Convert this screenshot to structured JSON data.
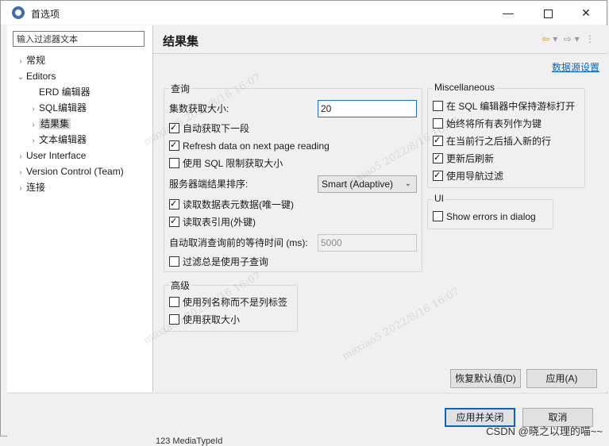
{
  "window": {
    "title": "首选项",
    "minimize_label": "—",
    "close_label": "✕"
  },
  "sidebar": {
    "filter_placeholder": "输入过滤器文本",
    "items": [
      {
        "label": "常规"
      },
      {
        "label": "Editors"
      },
      {
        "label": "ERD 编辑器"
      },
      {
        "label": "SQL编辑器"
      },
      {
        "label": "结果集"
      },
      {
        "label": "文本编辑器"
      },
      {
        "label": "User Interface"
      },
      {
        "label": "Version Control (Team)"
      },
      {
        "label": "连接"
      }
    ]
  },
  "page": {
    "title": "结果集",
    "datasource_link": "数据源设置"
  },
  "query_group": {
    "label": "查询",
    "fetch_size_label": "集数获取大小:",
    "fetch_size_value": "20",
    "auto_fetch_next": "自动获取下一段",
    "refresh_on_next_page": "Refresh data on next page reading",
    "use_sql_limit": "使用 SQL 限制获取大小",
    "server_order_label": "服务器端结果排序:",
    "server_order_value": "Smart (Adaptive)",
    "read_metadata": "读取数据表元数据(唯一键)",
    "read_references": "读取表引用(外键)",
    "auto_cancel_label": "自动取消查询前的等待时间 (ms):",
    "auto_cancel_value": "5000",
    "filter_subquery": "过滤总是使用子查询"
  },
  "misc_group": {
    "label": "Miscellaneous",
    "keep_cursor": "在 SQL 编辑器中保持游标打开",
    "always_all_columns_key": "始终将所有表列作为键",
    "insert_after_current": "在当前行之后插入新的行",
    "refresh_after_update": "更新后刷新",
    "use_nav_filter": "使用导航过滤"
  },
  "ui_group": {
    "label": "UI",
    "show_errors": "Show errors in dialog"
  },
  "advanced_group": {
    "label": "高级",
    "use_column_names": "使用列名称而不是列标签",
    "use_fetch_size": "使用获取大小"
  },
  "buttons": {
    "restore_defaults": "恢复默认值(D)",
    "apply": "应用(A)",
    "apply_close": "应用并关闭",
    "cancel": "取消"
  },
  "watermark_text": "maxiao5 2022/8/16 16:07",
  "footer_mark": "CSDN @晓之以理的喵~~",
  "behind_text": "123 MediaTypeId"
}
